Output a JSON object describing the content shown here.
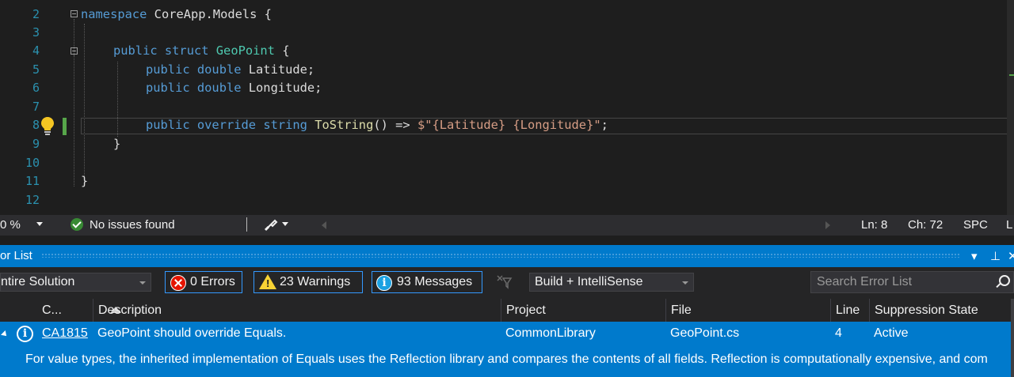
{
  "editor": {
    "line_numbers": [
      "2",
      "3",
      "4",
      "5",
      "6",
      "7",
      "8",
      "9",
      "10",
      "11",
      "12"
    ],
    "code": {
      "line2": {
        "kw": "namespace",
        "rest": " CoreApp.Models {"
      },
      "line4": {
        "kw1": "public",
        "kw2": "struct",
        "type": "GeoPoint",
        "rest": " {"
      },
      "line5": {
        "kw1": "public",
        "kw2": "double",
        "rest": " Latitude;"
      },
      "line6": {
        "kw1": "public",
        "kw2": "double",
        "rest": " Longitude;"
      },
      "line8": {
        "kw1": "public",
        "kw2": "override",
        "kw3": "string",
        "fn": "ToString",
        "mid": "() => ",
        "str": "$\"{Latitude} {Longitude}\"",
        "end": ";"
      },
      "line9": "}",
      "line11": "}"
    }
  },
  "editor_status": {
    "zoom": "0 %",
    "issues": "No issues found",
    "ln": "Ln: 8",
    "ch": "Ch: 72",
    "spc": "SPC",
    "crlf": "L"
  },
  "error_list": {
    "title": "or List",
    "titlebar_buttons": {
      "dropdown": "▾",
      "pin": "⊥",
      "close": "✕"
    },
    "scope": "ntire Solution",
    "errors": "0 Errors",
    "warnings": "23 Warnings",
    "messages": "93 Messages",
    "build_filter": "Build + IntelliSense",
    "search_placeholder": "Search Error List",
    "columns": [
      "C...",
      "Description",
      "Project",
      "File",
      "Line",
      "Suppression State"
    ],
    "rows": [
      {
        "code": "CA1815",
        "description": "GeoPoint should override Equals.",
        "project": "CommonLibrary",
        "file": "GeoPoint.cs",
        "line": "4",
        "suppression": "Active",
        "detail": "For value types, the inherited implementation of Equals uses the Reflection library and compares the contents of all fields. Reflection is computationally expensive, and com"
      }
    ]
  }
}
